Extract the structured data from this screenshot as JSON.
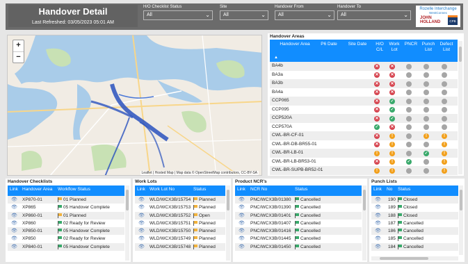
{
  "header": {
    "title": "Handover Detail",
    "refreshed": "Last Refreshed: 03/05/2023 05:01 AM",
    "filters": [
      {
        "label": "H/O Checklist Status",
        "value": "All"
      },
      {
        "label": "Site",
        "value": "All"
      },
      {
        "label": "Handover From",
        "value": "All"
      },
      {
        "label": "Handover To",
        "value": "All"
      }
    ],
    "logo": {
      "line1": "Rozelle Interchange",
      "line2": "WestConnex",
      "line3": "JOHN",
      "line4": "HOLLAND",
      "line5": "CPB"
    }
  },
  "map": {
    "zoom_in": "+",
    "zoom_out": "−",
    "attribution": "Leaflet | Hosted Map | Map data © OpenStreetMap contributors, CC-BY-SA"
  },
  "areas": {
    "title": "Handover Areas",
    "columns": [
      "Handover Area",
      "P6 Date",
      "Site Date",
      "H/O C/L",
      "Work Lot",
      "PNCR",
      "Punch List",
      "Defect List"
    ],
    "rows": [
      {
        "name": "BA4b",
        "s": [
          "red",
          "red",
          "gray",
          "gray",
          "gray"
        ]
      },
      {
        "name": "BA3a",
        "s": [
          "red",
          "red",
          "gray",
          "gray",
          "gray"
        ]
      },
      {
        "name": "BA3b",
        "s": [
          "red",
          "red",
          "gray",
          "gray",
          "gray"
        ]
      },
      {
        "name": "BA4a",
        "s": [
          "red",
          "red",
          "gray",
          "gray",
          "gray"
        ]
      },
      {
        "name": "CCP065",
        "s": [
          "red",
          "green",
          "gray",
          "gray",
          "gray"
        ]
      },
      {
        "name": "CCP095",
        "s": [
          "red",
          "green",
          "gray",
          "gray",
          "gray"
        ]
      },
      {
        "name": "CCP520A",
        "s": [
          "red",
          "green",
          "gray",
          "gray",
          "gray"
        ]
      },
      {
        "name": "CCP570A",
        "s": [
          "green",
          "red",
          "gray",
          "gray",
          "gray"
        ]
      },
      {
        "name": "CWL-BR-CF-01",
        "s": [
          "red",
          "orange",
          "gray",
          "orange",
          "orange"
        ]
      },
      {
        "name": "CWL-BR-DB-BR55-01",
        "s": [
          "red",
          "orange",
          "gray",
          "gray",
          "orange"
        ]
      },
      {
        "name": "CWL-BR-LB-01",
        "s": [
          "orange",
          "orange",
          "gray",
          "green",
          "orange"
        ]
      },
      {
        "name": "CWL-BR-LB-BR53-01",
        "s": [
          "red",
          "orange",
          "green",
          "gray",
          "orange"
        ]
      },
      {
        "name": "CWL-BR-SUPB-BR52-01",
        "s": [
          "orange",
          "orange",
          "gray",
          "gray",
          "orange"
        ]
      }
    ]
  },
  "checklists": {
    "title": "Handover Checklists",
    "columns": [
      "Link",
      "Handover Area",
      "Workflow Status"
    ],
    "rows": [
      {
        "area": "XP870-01",
        "status": "01 Planned",
        "color": "#f2b33d"
      },
      {
        "area": "XP865",
        "status": "05 Handover Complete",
        "color": "#39a96b"
      },
      {
        "area": "XP860-01",
        "status": "01 Planned",
        "color": "#f2b33d"
      },
      {
        "area": "XP860",
        "status": "02 Ready for Review",
        "color": "#39a96b"
      },
      {
        "area": "XP850-01",
        "status": "05 Handover Complete",
        "color": "#39a96b"
      },
      {
        "area": "XP850",
        "status": "02 Ready for Review",
        "color": "#39a96b"
      },
      {
        "area": "XP840-01",
        "status": "05 Handover Complete",
        "color": "#39a96b"
      }
    ]
  },
  "worklots": {
    "title": "Work Lots",
    "columns": [
      "Link",
      "Work Lot No",
      "Status"
    ],
    "rows": [
      {
        "no": "WLD/WCX3B/15754",
        "status": "Planned",
        "color": "#f2b33d"
      },
      {
        "no": "WLD/WCX3B/15753",
        "status": "Planned",
        "color": "#f2b33d"
      },
      {
        "no": "WLD/WCX3B/15752",
        "status": "Open",
        "color": "#f2b33d"
      },
      {
        "no": "WLD/WCX3B/15751",
        "status": "Planned",
        "color": "#f2b33d"
      },
      {
        "no": "WLD/WCX3B/15750",
        "status": "Planned",
        "color": "#f2b33d"
      },
      {
        "no": "WLD/WCX3B/15749",
        "status": "Planned",
        "color": "#f2b33d"
      },
      {
        "no": "WLD/WCX3B/15748",
        "status": "Planned",
        "color": "#f2b33d"
      }
    ]
  },
  "ncrs": {
    "title": "Product NCR's",
    "columns": [
      "Link",
      "NCR No",
      "Status"
    ],
    "rows": [
      {
        "no": "PNC/WCX3B/01380",
        "status": "Cancelled",
        "color": "#39a96b"
      },
      {
        "no": "PNC/WCX3B/01390",
        "status": "Cancelled",
        "color": "#39a96b"
      },
      {
        "no": "PNC/WCX3B/01401",
        "status": "Cancelled",
        "color": "#39a96b"
      },
      {
        "no": "PNC/WCX3B/01407",
        "status": "Cancelled",
        "color": "#39a96b"
      },
      {
        "no": "PNC/WCX3B/01416",
        "status": "Cancelled",
        "color": "#39a96b"
      },
      {
        "no": "PNC/WCX3B/01445",
        "status": "Cancelled",
        "color": "#39a96b"
      },
      {
        "no": "PNC/WCX3B/01450",
        "status": "Cancelled",
        "color": "#39a96b"
      }
    ]
  },
  "punch": {
    "title": "Punch Lists",
    "columns": [
      "Link",
      "No",
      "Status"
    ],
    "rows": [
      {
        "no": "190",
        "status": "Closed",
        "color": "#39a96b"
      },
      {
        "no": "189",
        "status": "Closed",
        "color": "#39a96b"
      },
      {
        "no": "188",
        "status": "Closed",
        "color": "#39a96b"
      },
      {
        "no": "187",
        "status": "Cancelled",
        "color": "#39a96b"
      },
      {
        "no": "186",
        "status": "Cancelled",
        "color": "#39a96b"
      },
      {
        "no": "185",
        "status": "Cancelled",
        "color": "#39a96b"
      },
      {
        "no": "184",
        "status": "Cancelled",
        "color": "#39a96b"
      }
    ]
  }
}
